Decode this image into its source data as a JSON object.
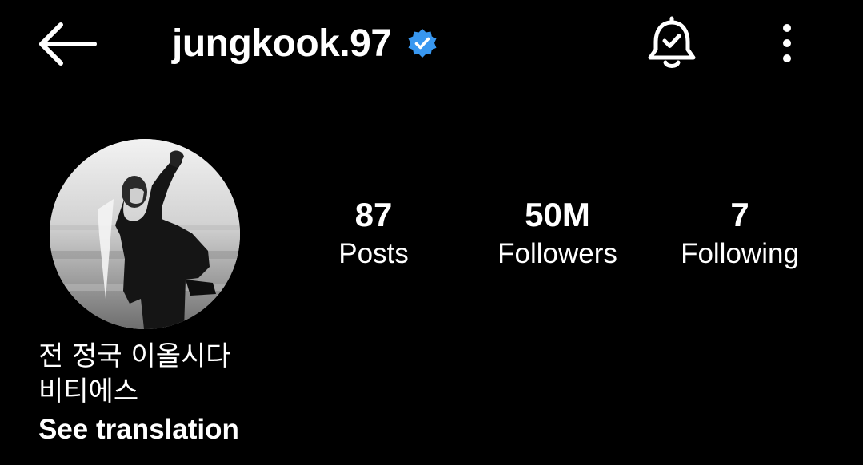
{
  "header": {
    "back_icon": "arrow-left-icon",
    "username": "jungkook.97",
    "verified_icon": "verified-badge-icon",
    "verified_color": "#3897f0",
    "notifications_icon": "bell-check-icon",
    "more_icon": "more-vertical-icon"
  },
  "profile": {
    "avatar_icon": "profile-photo",
    "stats": [
      {
        "value": "87",
        "label": "Posts"
      },
      {
        "value": "50M",
        "label": "Followers"
      },
      {
        "value": "7",
        "label": "Following"
      }
    ],
    "bio_lines": [
      "전 정국 이올시다",
      "비티에스"
    ],
    "see_translation": "See translation"
  },
  "colors": {
    "background": "#000000",
    "text": "#ffffff"
  }
}
